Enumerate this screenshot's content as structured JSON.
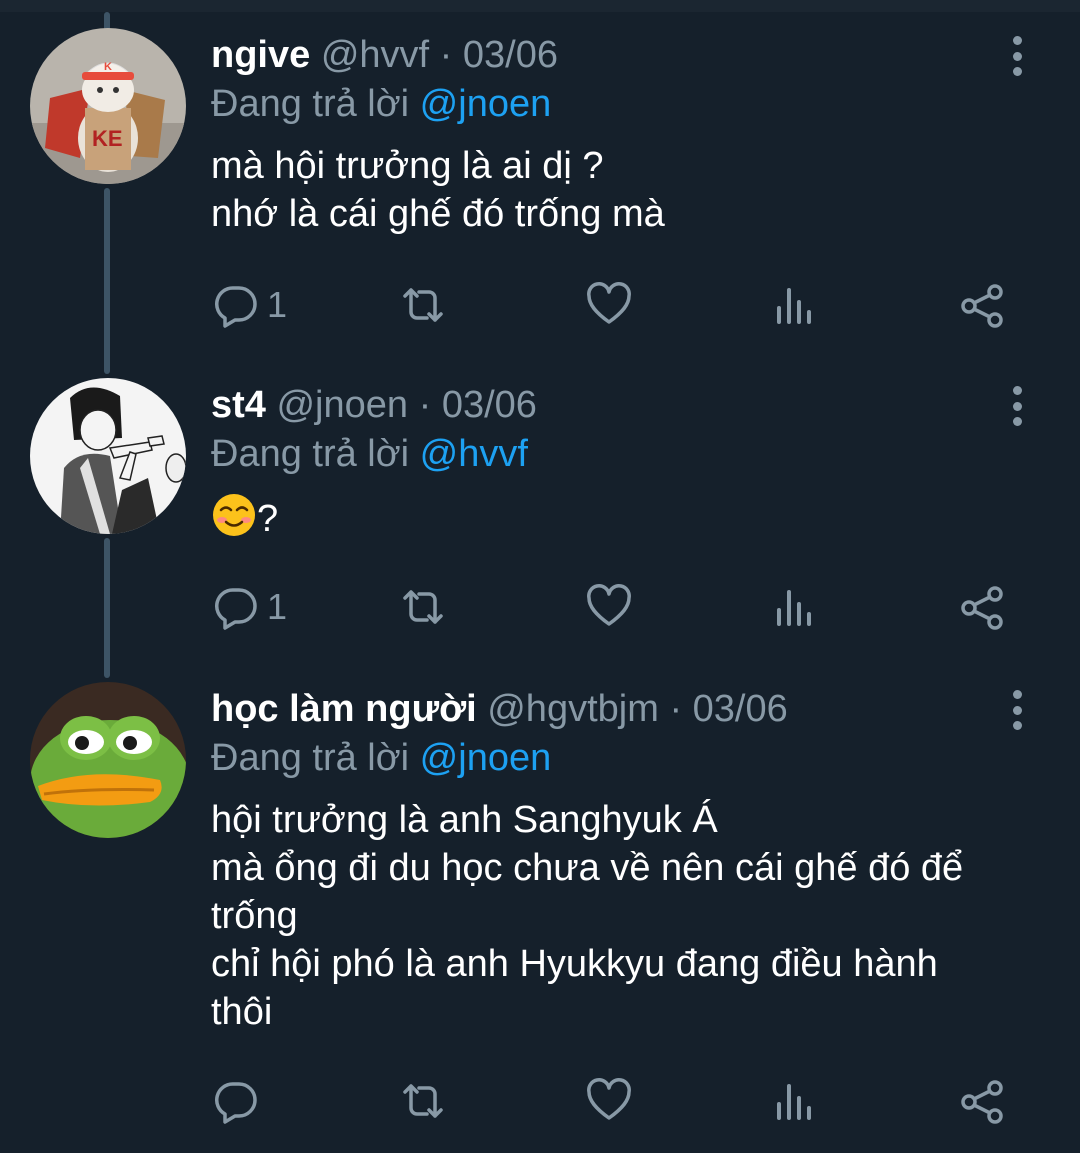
{
  "tweets": [
    {
      "display_name": "ngive",
      "handle": "@hvvf",
      "date": "03/06",
      "separator": "·",
      "replying_prefix": "Đang trả lời",
      "replying_to": "@jnoen",
      "body_lines": [
        "mà hội trưởng là ai dị ?",
        "nhớ là cái ghế đó trống mà"
      ],
      "reply_count": "1",
      "avatar": "cat-avatar"
    },
    {
      "display_name": "st4",
      "handle": "@jnoen",
      "date": "03/06",
      "separator": "·",
      "replying_prefix": "Đang trả lời",
      "replying_to": "@hvvf",
      "body_suffix": "?",
      "body_emoji": "smiling-face-emoji",
      "reply_count": "1",
      "avatar": "manga-avatar"
    },
    {
      "display_name": "học làm người",
      "handle": "@hgvtbjm",
      "date": "03/06",
      "separator": "·",
      "replying_prefix": "Đang trả lời",
      "replying_to": "@jnoen",
      "body_lines": [
        "hội trưởng là anh Sanghyuk Á",
        "mà ổng đi du học chưa về nên cái ghế đó để",
        "trống",
        "chỉ hội phó là anh Hyukkyu đang điều hành",
        "thôi"
      ],
      "reply_count": "",
      "avatar": "frog-avatar"
    }
  ],
  "icons": [
    "reply-icon",
    "retweet-icon",
    "like-icon",
    "analytics-icon",
    "share-icon",
    "more-icon"
  ],
  "colors": {
    "background": "#15202b",
    "text": "#ffffff",
    "muted": "#8899a6",
    "accent": "#1da1f2",
    "thread_line": "#3d5466"
  }
}
